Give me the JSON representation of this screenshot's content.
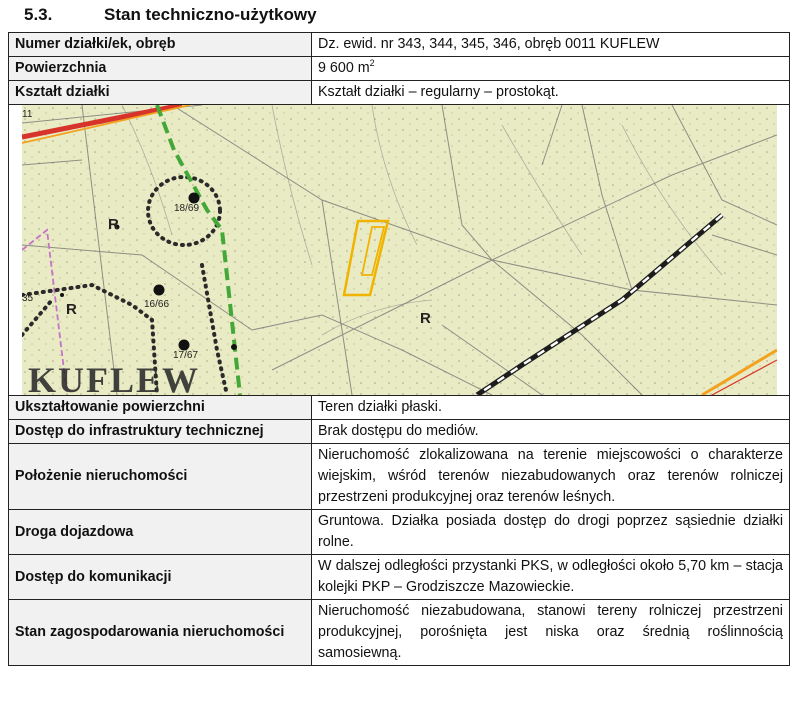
{
  "heading": {
    "number": "5.3.",
    "title": "Stan techniczno-użytkowy"
  },
  "rows": {
    "parcel_number": {
      "label": "Numer działki/ek, obręb",
      "value": "Dz. ewid. nr 343, 344, 345, 346, obręb 0011 KUFLEW"
    },
    "area": {
      "label": "Powierzchnia",
      "value": "9 600 m",
      "unit_sup": "2"
    },
    "shape": {
      "label": "Kształt działki",
      "value": "Kształt działki – regularny – prostokąt."
    },
    "surface": {
      "label": "Ukształtowanie powierzchni",
      "value": "Teren działki płaski."
    },
    "infrastructure": {
      "label": "Dostęp do infrastruktury technicznej",
      "value": "Brak dostępu do mediów."
    },
    "location": {
      "label": "Położenie nieruchomości",
      "value": "Nieruchomość zlokalizowana na terenie miejscowości o charakterze wiejskim, wśród terenów niezabudowanych oraz terenów rolniczej przestrzeni produkcyjnej oraz terenów leśnych."
    },
    "access_road": {
      "label": "Droga dojazdowa",
      "value": "Gruntowa. Działka posiada dostęp do drogi poprzez sąsiednie działki rolne."
    },
    "transport": {
      "label": "Dostęp do komunikacji",
      "value": "W dalszej odległości przystanki PKS, w odległości około 5,70 km – stacja kolejki PKP – Grodziszcze Mazowieckie."
    },
    "development": {
      "label": "Stan zagospodarowania nieruchomości",
      "value": "Nieruchomość niezabudowana, stanowi tereny rolniczej przestrzeni produkcyjnej, porośnięta jest niska oraz średnią roślinnością samosiewną."
    }
  },
  "map": {
    "town_label": "KUFLEW",
    "land_class_labels": [
      "R",
      "R",
      "R"
    ],
    "parcel_labels": [
      "18/69",
      "16/66",
      "17/67",
      "35",
      "11"
    ],
    "colors": {
      "background": "#e9ebc4",
      "parcel_outline": "#f0b400",
      "forest_boundary": "#43a838",
      "road_red": "#d8332a",
      "road_yellow": "#f2a21e"
    }
  }
}
